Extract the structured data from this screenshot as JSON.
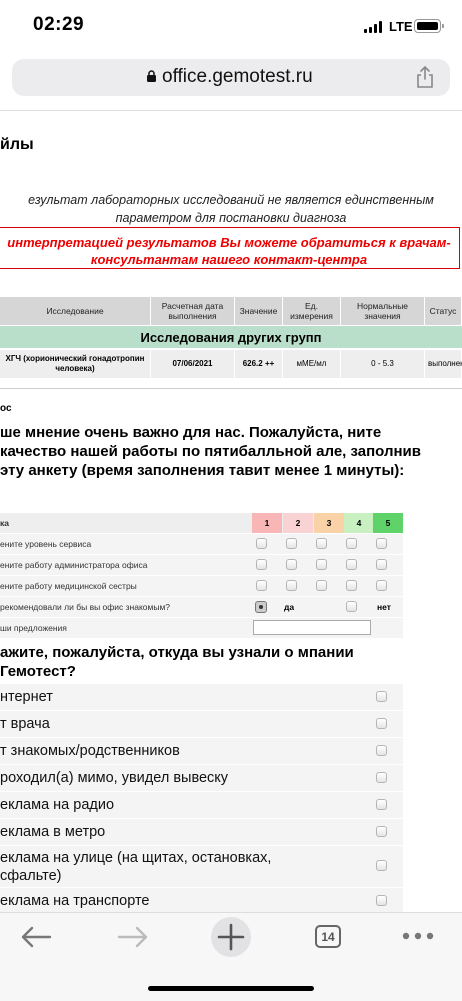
{
  "status": {
    "time": "02:29",
    "network": "LTE"
  },
  "browser": {
    "url": "office.gemotest.ru",
    "tab_count": "14"
  },
  "page": {
    "title": "йлы",
    "disclaimer_line1": "езультат лабораторных исследований не является единственным",
    "disclaimer_line2": "параметром для постановки диагноза",
    "notice_line1": "интерпретацией результатов Вы можете обратиться к врачам-",
    "notice_line2": "консультантам нашего контакт-центра"
  },
  "results_table": {
    "headers": [
      "Исследование",
      "Расчетная дата выполнения",
      "Значение",
      "Ед. измерения",
      "Нормальные значения",
      "Статус"
    ],
    "group_title": "Исследования других групп",
    "rows": [
      {
        "test": "ХГЧ (хорионический гонадотропин человека)",
        "date": "07/06/2021",
        "value": "626.2 ++",
        "unit": "мМЕ/мл",
        "normal": "0 - 5.3",
        "status": "выполнен"
      }
    ]
  },
  "survey": {
    "label": "ос",
    "intro": "ше мнение очень важно для нас. Пожалуйста, ните качество нашей работы по пятибалльной але, заполнив эту анкету (время заполнения тавит менее 1 минуты):",
    "grid_header": "ка",
    "scores": [
      "1",
      "2",
      "3",
      "4",
      "5"
    ],
    "score_colors": [
      "#f8b6b6",
      "#f9d3d3",
      "#f9d2a8",
      "#c8f0c1",
      "#5fd36a"
    ],
    "questions": [
      "ените уровень сервиса",
      "ените работу администратора офиса",
      "ените работу медицинской сестры",
      "рекомендовали ли бы вы офис знакомым?",
      "ши предложения"
    ],
    "recommend_yes": "да",
    "recommend_no": "нет",
    "source_question": "ажите, пожалуйста, откуда вы узнали о мпании Гемотест?",
    "sources": [
      "нтернет",
      "т врача",
      "т знакомых/родственников",
      "роходил(а) мимо, увидел вывеску",
      "еклама на радио",
      "еклама в метро",
      "еклама на улице (на щитах, остановках, сфальте)",
      "еклама на транспорте"
    ]
  },
  "icons": [
    "lock-icon",
    "share-icon",
    "back-arrow-icon",
    "forward-arrow-icon",
    "new-tab-plus-icon",
    "tabs-icon",
    "more-dots-icon"
  ]
}
